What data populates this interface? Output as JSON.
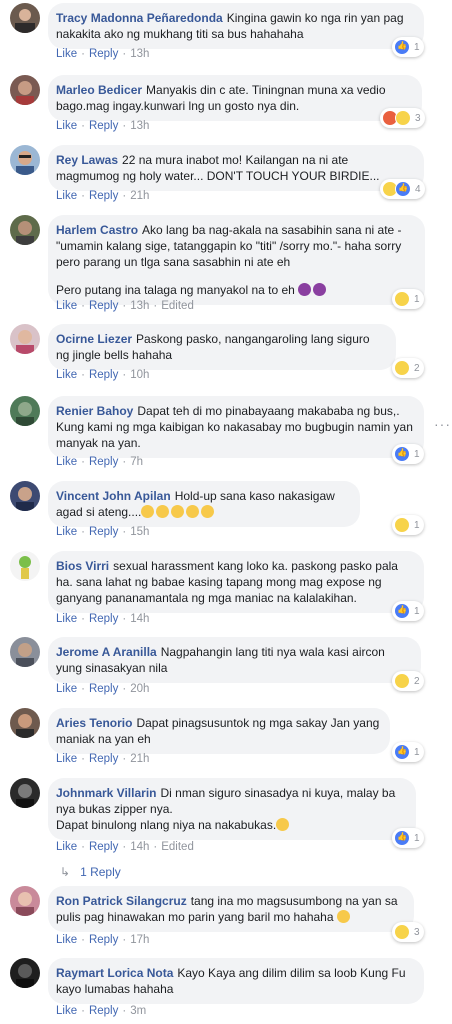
{
  "actions": {
    "like": "Like",
    "reply": "Reply",
    "edited": "Edited",
    "more": "···"
  },
  "comments": [
    {
      "author": "Tracy Madonna Peñaredonda",
      "text": "Kingina gawin ko nga rin yan pag nakakita ako ng mukhang titi sa bus hahahaha",
      "time": "13h",
      "reaction_count": "1"
    },
    {
      "author": "Marleo Bedicer",
      "text": "Manyakis din c ate. Tiningnan muna xa vedio bago.mag ingay.kunwari lng un gosto nya din.",
      "time": "13h",
      "reaction_count": "3"
    },
    {
      "author": "Rey Lawas",
      "text": "22 na mura inabot mo! Kailangan na ni ate magmumog ng holy water... DON'T TOUCH YOUR BIRDIE...",
      "time": "21h",
      "reaction_count": "4"
    },
    {
      "author": "Harlem Castro",
      "text": "Ako lang ba nag-akala na sasabihin sana ni ate - \"umamin kalang sige, tatanggapin ko \"titi\" /sorry mo.\"- haha sorry pero parang un tlga sana sasabhin ni ate eh",
      "text2": "Pero putang ina talaga ng manyakol na to eh",
      "time": "13h",
      "reaction_count": "1"
    },
    {
      "author": "Ocirne Liezer",
      "text": "Paskong pasko, nangangaroling lang siguro ng jingle bells hahaha",
      "time": "10h",
      "reaction_count": "2"
    },
    {
      "author": "Renier Bahoy",
      "text": "Dapat teh di mo pinabayaang makababa ng bus,. Kung kami ng mga kaibigan ko nakasabay mo bugbugin namin yan manyak na yan.",
      "time": "7h",
      "reaction_count": "1"
    },
    {
      "author": "Vincent John Apilan",
      "text": "Hold-up sana kaso nakasigaw agad si ateng....",
      "time": "15h",
      "reaction_count": "1"
    },
    {
      "author": "Bios Virri",
      "text": "sexual harassment kang loko ka. paskong pasko pala ha. sana lahat ng babae kasing tapang mong mag expose ng ganyang pananamantala ng mga maniac na kalalakihan.",
      "time": "14h",
      "reaction_count": "1"
    },
    {
      "author": "Jerome A Aranilla",
      "text": "Nagpahangin lang titi nya wala kasi aircon yung sinasakyan nila",
      "time": "20h",
      "reaction_count": "2"
    },
    {
      "author": "Aries Tenorio",
      "text": "Dapat pinagsusuntok ng mga sakay Jan yang maniak na yan eh",
      "time": "21h",
      "reaction_count": "1"
    },
    {
      "author": "Johnmark Villarin",
      "text": "Di nman siguro sinasadya ni kuya, malay ba nya bukas zipper nya.",
      "text2": "Dapat binulong nlang niya na nakabukas.",
      "time": "14h",
      "reaction_count": "1",
      "replies_label": "1 Reply"
    },
    {
      "author": "Ron Patrick Silangcruz",
      "text": "tang ina mo magsusumbong na yan sa pulis pag hinawakan mo parin yang baril mo hahaha",
      "time": "17h",
      "reaction_count": "3"
    },
    {
      "author": "Raymart Lorica Nota",
      "text": "Kayo Kaya ang dilim dilim sa loob Kung Fu kayo lumabas hahaha",
      "time": "3m"
    }
  ],
  "colors": {
    "author": "#385898",
    "link": "#4267b2",
    "bubble": "#f2f3f5",
    "meta": "#90949c"
  }
}
